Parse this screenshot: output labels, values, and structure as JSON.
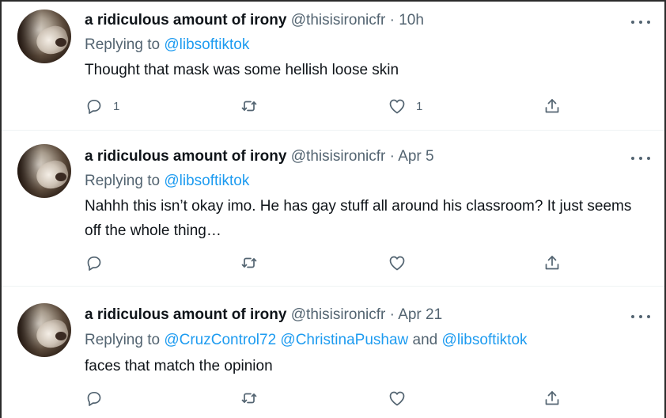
{
  "tweets": [
    {
      "name": "a ridiculous amount of irony",
      "handle": "@thisisironicfr",
      "sep": "·",
      "time": "10h",
      "replying_prefix": "Replying to",
      "mentions": "@libsoftiktok",
      "mentions_joiner": "",
      "mentions_rest": "",
      "text": "Thought that mask was some hellish loose skin",
      "reply_count": "1",
      "retweet_count": "",
      "like_count": "1"
    },
    {
      "name": "a ridiculous amount of irony",
      "handle": "@thisisironicfr",
      "sep": "·",
      "time": "Apr 5",
      "replying_prefix": "Replying to",
      "mentions": "@libsoftiktok",
      "mentions_joiner": "",
      "mentions_rest": "",
      "text": "Nahhh this isn’t okay imo. He has gay stuff all around his classroom? It just seems off the whole thing…",
      "reply_count": "",
      "retweet_count": "",
      "like_count": ""
    },
    {
      "name": "a ridiculous amount of irony",
      "handle": "@thisisironicfr",
      "sep": "·",
      "time": "Apr 21",
      "replying_prefix": "Replying to",
      "mentions": "@CruzControl72 @ChristinaPushaw",
      "mentions_joiner": "and",
      "mentions_rest": "@libsoftiktok",
      "text": "faces that match the opinion",
      "reply_count": "",
      "retweet_count": "",
      "like_count": ""
    }
  ],
  "icons": {
    "reply": "reply-icon",
    "retweet": "retweet-icon",
    "like": "heart-icon",
    "share": "share-icon",
    "more": "more-icon"
  },
  "colors": {
    "link": "#1d9bf0",
    "secondary_text": "#536471",
    "primary_text": "#0f1419"
  }
}
